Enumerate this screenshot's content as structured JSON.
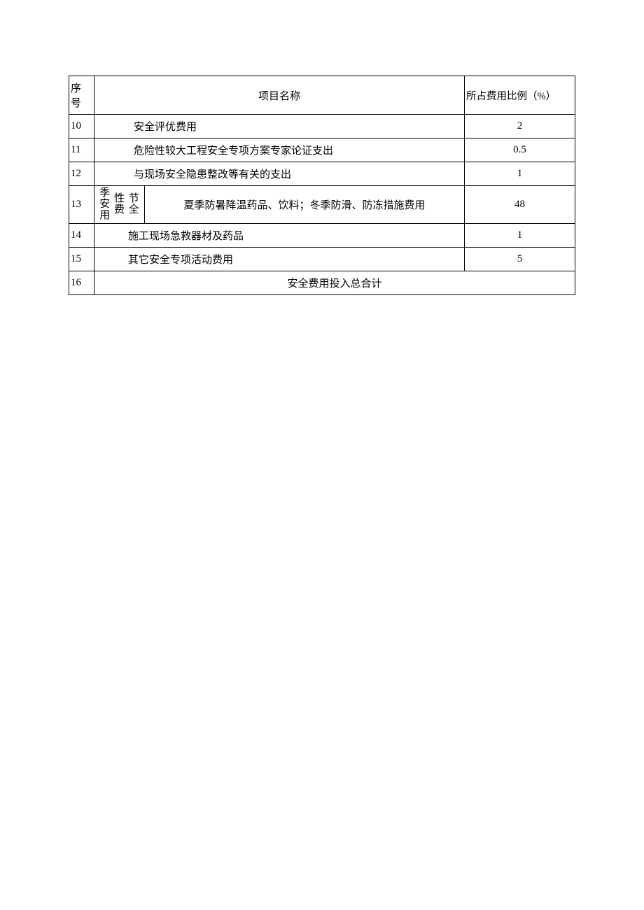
{
  "headers": {
    "seq": "序号",
    "name": "项目名称",
    "ratio": "所占费用比例（%）"
  },
  "rows": [
    {
      "seq": "10",
      "name": "安全评优费用",
      "ratio": "2"
    },
    {
      "seq": "11",
      "name": "危险性较大工程安全专项方案专家论证支出",
      "ratio": "0.5"
    },
    {
      "seq": "12",
      "name": "与现场安全隐患整改等有关的支出",
      "ratio": "1"
    }
  ],
  "vertRow": {
    "seq": "13",
    "col1": [
      "季",
      "安",
      "用"
    ],
    "col2": [
      "性",
      "费"
    ],
    "col3": [
      "节",
      "全"
    ],
    "name": "夏季防暑降温药品、饮料；冬季防滑、防冻措施费用",
    "ratio": "48"
  },
  "rowsAfter": [
    {
      "seq": "14",
      "name": "施工现场急救器材及药品",
      "ratio": "1"
    },
    {
      "seq": "15",
      "name": "其它安全专项活动费用",
      "ratio": "5"
    }
  ],
  "totalRow": {
    "seq": "16",
    "label": "安全费用投入总合计"
  }
}
